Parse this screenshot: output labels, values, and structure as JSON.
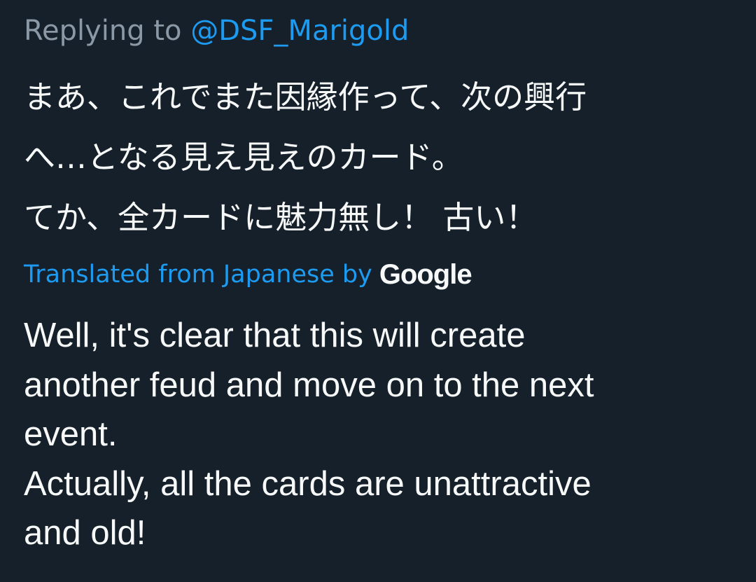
{
  "reply": {
    "prefix": "Replying to ",
    "handle": "@DSF_Marigold"
  },
  "original": {
    "lines": [
      "まあ、これでまた因縁作って、次の興行",
      "へ…となる見え見えのカード。",
      "てか、全カードに魅力無し！ 古い！"
    ]
  },
  "translation_notice": {
    "label": "Translated from Japanese by",
    "provider": "Google"
  },
  "translation": {
    "lines": [
      "Well, it's clear that this will create",
      "another feud and move on to the next",
      "event.",
      "Actually, all the cards are unattractive",
      "and old!"
    ]
  },
  "colors": {
    "background": "#15202b",
    "muted": "#8b98a5",
    "accent": "#1d9bf0",
    "text": "#f7f9f9"
  }
}
